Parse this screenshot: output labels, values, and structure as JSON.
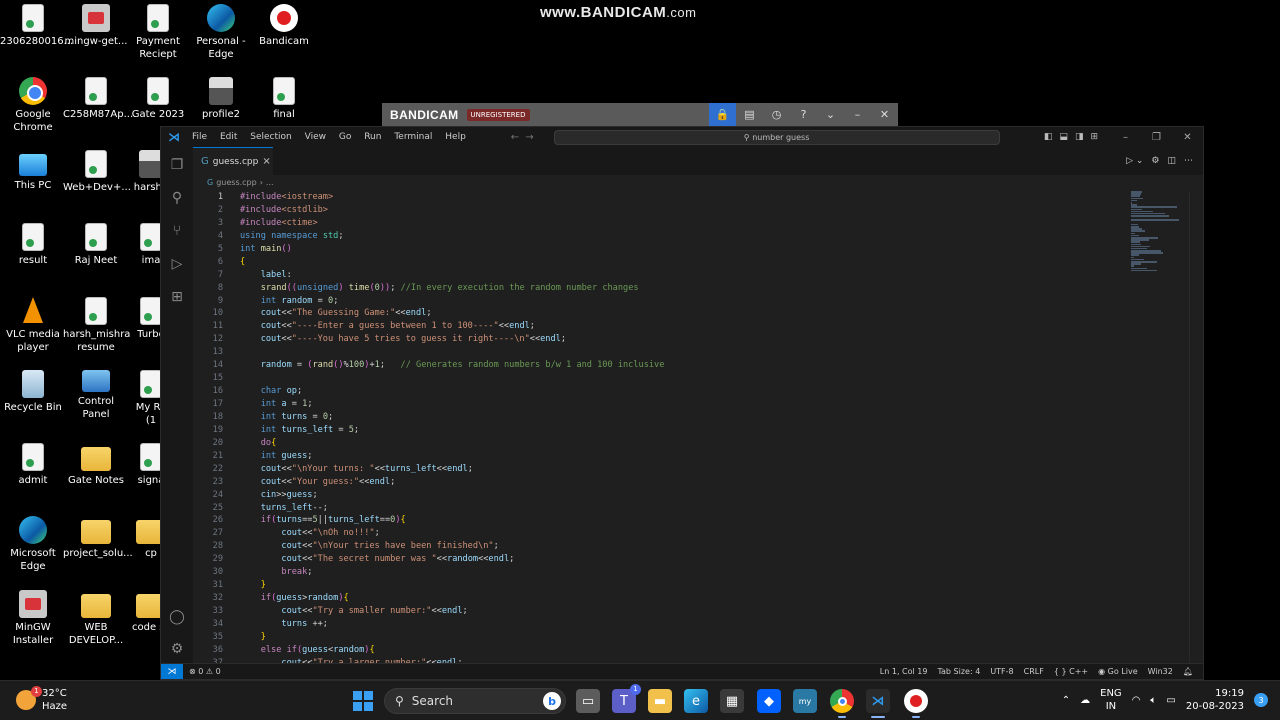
{
  "watermark": {
    "main": "www.BANDICAM",
    "suffix": ".com"
  },
  "desktop_icons": [
    {
      "label": "2306280016...",
      "type": "doc"
    },
    {
      "label": "mingw-get...",
      "type": "mingw"
    },
    {
      "label": "Payment Reciept",
      "type": "doc"
    },
    {
      "label": "Personal - Edge",
      "type": "edge"
    },
    {
      "label": "Bandicam",
      "type": "bandiapp"
    },
    {
      "label": "Google Chrome",
      "type": "chrome"
    },
    {
      "label": "C258M87Ap...",
      "type": "doc"
    },
    {
      "label": "Gate 2023",
      "type": "doc"
    },
    {
      "label": "profile2",
      "type": "person"
    },
    {
      "label": "final",
      "type": "doc"
    },
    {
      "label": "This PC",
      "type": "pc"
    },
    {
      "label": "Web+Dev+...",
      "type": "doc"
    },
    {
      "label": "harshp",
      "type": "person"
    },
    {
      "label": "result",
      "type": "doc"
    },
    {
      "label": "Raj Neet",
      "type": "doc"
    },
    {
      "label": "ima",
      "type": "doc"
    },
    {
      "label": "VLC media player",
      "type": "vlc"
    },
    {
      "label": "harsh_mishra resume",
      "type": "doc"
    },
    {
      "label": "Turbo",
      "type": "doc"
    },
    {
      "label": "Recycle Bin",
      "type": "bin"
    },
    {
      "label": "Control Panel",
      "type": "cpanel"
    },
    {
      "label": "My Re (1",
      "type": "doc"
    },
    {
      "label": "admit",
      "type": "doc"
    },
    {
      "label": "Gate Notes",
      "type": "folder"
    },
    {
      "label": "signa",
      "type": "doc"
    },
    {
      "label": "Microsoft Edge",
      "type": "edge"
    },
    {
      "label": "project_solu...",
      "type": "folder"
    },
    {
      "label": "cp",
      "type": "folder"
    },
    {
      "label": "MinGW Installer",
      "type": "mingw"
    },
    {
      "label": "WEB DEVELOP...",
      "type": "folder"
    },
    {
      "label": "code sc",
      "type": "folder"
    }
  ],
  "bandicam_bar": {
    "logo": "BANDICAM",
    "status": "UNREGISTERED"
  },
  "vscode": {
    "menu": [
      "File",
      "Edit",
      "Selection",
      "View",
      "Go",
      "Run",
      "Terminal",
      "Help"
    ],
    "command_center": "number guess",
    "tab": {
      "label": "guess.cpp",
      "close": "×"
    },
    "breadcrumb": {
      "file": "guess.cpp",
      "sep": "›",
      "rest": "..."
    },
    "current_line": 1,
    "status": {
      "problems": "⊗ 0 ⚠ 0",
      "position": "Ln 1, Col 19",
      "tab_size": "Tab Size: 4",
      "encoding": "UTF-8",
      "eol": "CRLF",
      "language": "{ } C++",
      "golive": "Go Live",
      "platform": "Win32"
    }
  },
  "code_lines": [
    "#include<iostream>",
    "#include<cstdlib>",
    "#include<ctime>",
    "using namespace std;",
    "int main()",
    "{",
    "    label:",
    "    srand((unsigned) time(0)); //In every execution the random number changes",
    "    int random = 0;",
    "    cout<<\"The Guessing Game:\"<<endl;",
    "    cout<<\"----Enter a guess between 1 to 100----\"<<endl;",
    "    cout<<\"----You have 5 tries to guess it right----\\n\"<<endl;",
    "",
    "    random = (rand()%100)+1;   // Generates random numbers b/w 1 and 100 inclusive",
    "",
    "    char op;",
    "    int a = 1;",
    "    int turns = 0;",
    "    int turns_left = 5;",
    "    do{",
    "    int guess;",
    "    cout<<\"\\nYour turns: \"<<turns_left<<endl;",
    "    cout<<\"Your guess:\"<<endl;",
    "    cin>>guess;",
    "    turns_left--;",
    "    if(turns==5||turns_left==0){",
    "        cout<<\"\\nOh no!!!\";",
    "        cout<<\"\\nYour tries have been finished\\n\";",
    "        cout<<\"The secret number was \"<<random<<endl;",
    "        break;",
    "    }",
    "    if(guess>random){",
    "        cout<<\"Try a smaller number:\"<<endl;",
    "        turns ++;",
    "    }",
    "    else if(guess<random){",
    "        cout<<\"Try a larger number:\"<<endl;"
  ],
  "taskbar": {
    "weather": {
      "temp": "32°C",
      "desc": "Haze",
      "badge": "1"
    },
    "search_label": "Search",
    "apps": [
      "task-view",
      "teams",
      "file-explorer",
      "edge",
      "store",
      "dropbox",
      "mysql",
      "chrome",
      "vscode",
      "bandicam"
    ],
    "teams_badge": "1",
    "lang": {
      "line1": "ENG",
      "line2": "IN"
    },
    "clock": {
      "time": "19:19",
      "date": "20-08-2023"
    },
    "notifications": "3"
  }
}
